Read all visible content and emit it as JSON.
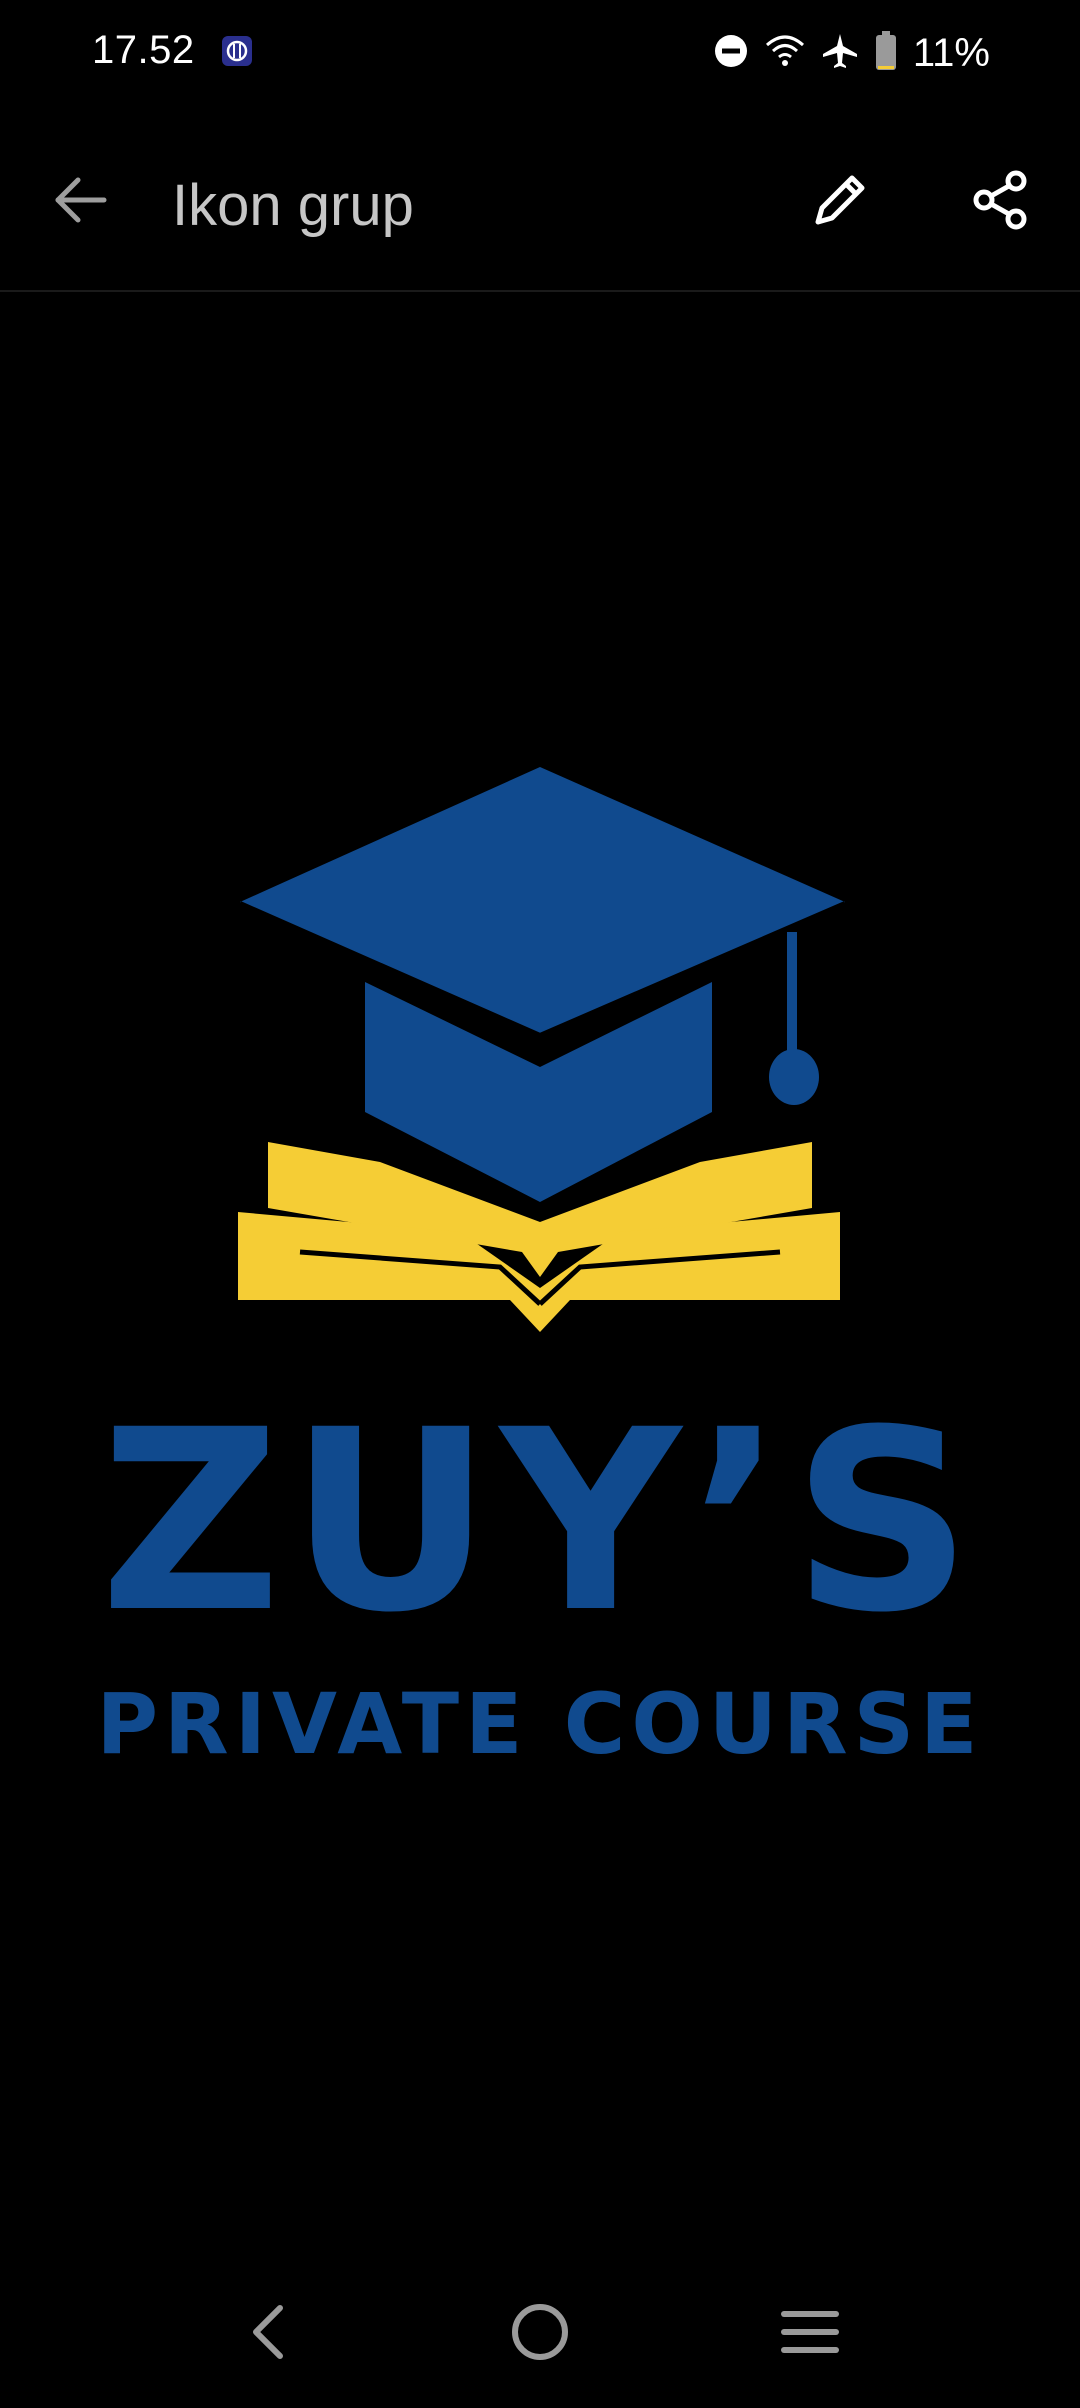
{
  "status_bar": {
    "time": "17.52",
    "battery_percent": "11%",
    "battery_level": 0.11,
    "icons": [
      "app-notification-icon",
      "do-not-disturb-icon",
      "wifi-icon",
      "airplane-mode-icon",
      "battery-icon"
    ]
  },
  "app_bar": {
    "title": "Ikon grup",
    "back_icon": "arrow-left-icon",
    "edit_icon": "pencil-icon",
    "share_icon": "share-icon"
  },
  "group_image": {
    "logo_title": "ZUY’S",
    "logo_subtitle": "PRIVATE COURSE",
    "colors": {
      "background": "#000000",
      "brand_blue": "#104a8e",
      "book_yellow": "#f5cd35"
    }
  },
  "nav_bar": {
    "icons": [
      "nav-back-icon",
      "nav-home-icon",
      "nav-recents-icon"
    ]
  }
}
